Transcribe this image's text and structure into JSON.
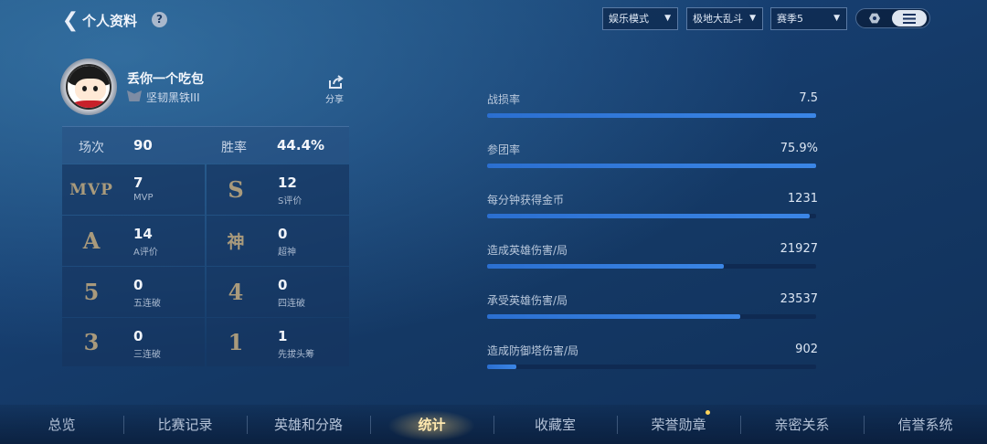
{
  "header": {
    "title": "个人资料",
    "help_label": "?",
    "filters": [
      {
        "value": "娱乐模式"
      },
      {
        "value": "极地大乱斗"
      },
      {
        "value": "赛季5"
      }
    ]
  },
  "profile": {
    "name": "丢你一个吃包",
    "rank": "坚韧黑铁III",
    "share_label": "分享"
  },
  "summary": {
    "matches_label": "场次",
    "matches_value": "90",
    "winrate_label": "胜率",
    "winrate_value": "44.4%"
  },
  "achievements": [
    {
      "badge": "MVP",
      "value": "7",
      "label": "MVP"
    },
    {
      "badge": "S",
      "value": "12",
      "label": "S评价"
    },
    {
      "badge": "A",
      "value": "14",
      "label": "A评价"
    },
    {
      "badge": "神",
      "value": "0",
      "label": "超神"
    },
    {
      "badge": "5",
      "value": "0",
      "label": "五连破"
    },
    {
      "badge": "4",
      "value": "0",
      "label": "四连破"
    },
    {
      "badge": "3",
      "value": "0",
      "label": "三连破"
    },
    {
      "badge": "1",
      "value": "1",
      "label": "先拔头筹"
    }
  ],
  "metrics": [
    {
      "label": "战损率",
      "value": "7.5",
      "fill": 1.0
    },
    {
      "label": "参团率",
      "value": "75.9%",
      "fill": 1.0
    },
    {
      "label": "每分钟获得金币",
      "value": "1231",
      "fill": 0.98
    },
    {
      "label": "造成英雄伤害/局",
      "value": "21927",
      "fill": 0.72
    },
    {
      "label": "承受英雄伤害/局",
      "value": "23537",
      "fill": 0.77
    },
    {
      "label": "造成防御塔伤害/局",
      "value": "902",
      "fill": 0.09
    }
  ],
  "nav": [
    {
      "label": "总览"
    },
    {
      "label": "比赛记录"
    },
    {
      "label": "英雄和分路"
    },
    {
      "label": "统计"
    },
    {
      "label": "收藏室"
    },
    {
      "label": "荣誉勋章"
    },
    {
      "label": "亲密关系"
    },
    {
      "label": "信誉系统"
    }
  ],
  "active_nav": "统计",
  "colors": {
    "accent": "#3b86e6",
    "active_tab": "#ffe9b0",
    "badge": "#a99a7c"
  }
}
